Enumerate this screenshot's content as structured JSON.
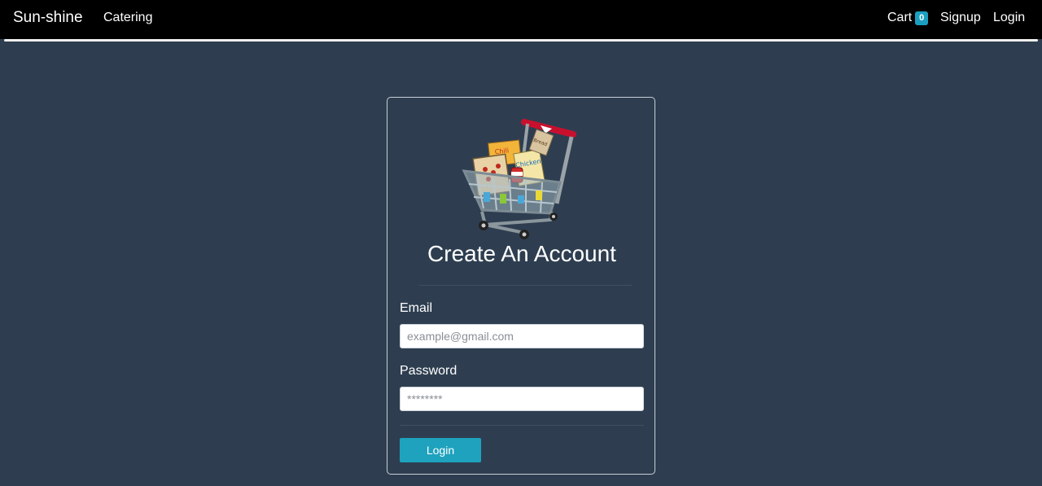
{
  "navbar": {
    "brand": "Sun-shine",
    "catering_label": "Catering",
    "cart_label": "Cart",
    "cart_count": "0",
    "signup_label": "Signup",
    "login_label": "Login"
  },
  "form": {
    "title": "Create An Account",
    "image_icon": "shopping-cart-with-groceries",
    "image_box_labels": [
      "Chili",
      "Chicken",
      "Bread"
    ],
    "email_label": "Email",
    "email_placeholder": "example@gmail.com",
    "email_value": "",
    "password_label": "Password",
    "password_placeholder": "********",
    "password_value": "",
    "submit_label": "Login"
  },
  "colors": {
    "background": "#2e3e50",
    "navbar": "#000000",
    "accent": "#1ea2bd",
    "badge": "#1b9fc0"
  }
}
